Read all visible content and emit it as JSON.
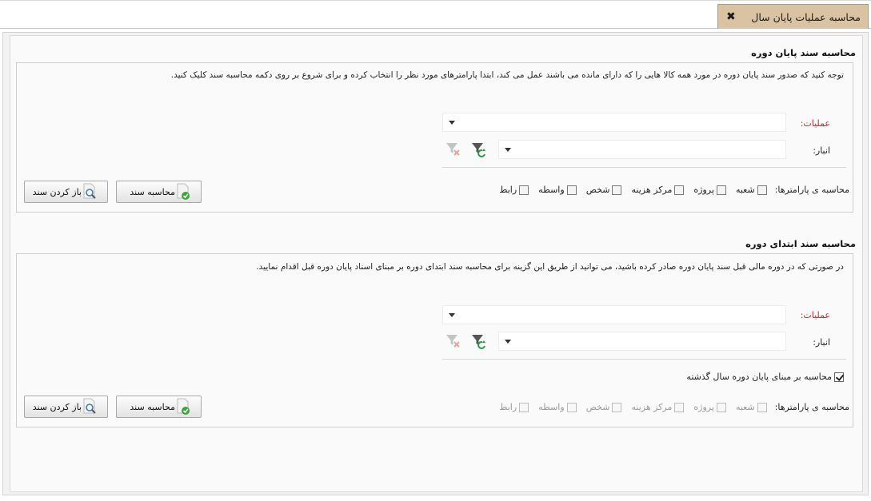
{
  "tab": {
    "title": "محاسبه عملیات پایان سال",
    "close_icon": "close-icon"
  },
  "section1": {
    "title": "محاسبه سند پایان دوره",
    "note": "توجه کنید که صدور سند پایان دوره در مورد همه کالا هایی را که دارای مانده می باشند عمل می کند، ابتدا پارامترهای مورد نظر را انتخاب کرده و برای شروع بر روی دکمه محاسبه سند کلیک کنید.",
    "operations_label": "عملیات:",
    "operations_value": "",
    "warehouse_label": "انبار:",
    "warehouse_value": "",
    "params_label": "محاسبه ی پارامترها:",
    "params": [
      "شعبه",
      "پروژه",
      "مرکز هزینه",
      "شخص",
      "واسطه",
      "رابط"
    ],
    "calc_button": "محاسبه سند",
    "open_button": "باز کردن سند"
  },
  "section2": {
    "title": "محاسبه سند ابتدای دوره",
    "note": "در صورتی که در دوره مالی قبل سند پایان دوره صادر کرده باشید، می توانید از طریق این گزینه برای محاسبه سند ابتدای دوره بر مبنای اسناد پایان دوره قبل اقدام نمایید.",
    "operations_label": "عملیات:",
    "operations_value": "",
    "warehouse_label": "انبار:",
    "warehouse_value": "",
    "prev_year_label": "محاسبه بر مبنای پایان دوره سال گذشته",
    "prev_year_checked": true,
    "params_label": "محاسبه ی پارامترها:",
    "params": [
      "شعبه",
      "پروژه",
      "مرکز هزینه",
      "شخص",
      "واسطه",
      "رابط"
    ],
    "calc_button": "محاسبه سند",
    "open_button": "باز کردن سند"
  }
}
